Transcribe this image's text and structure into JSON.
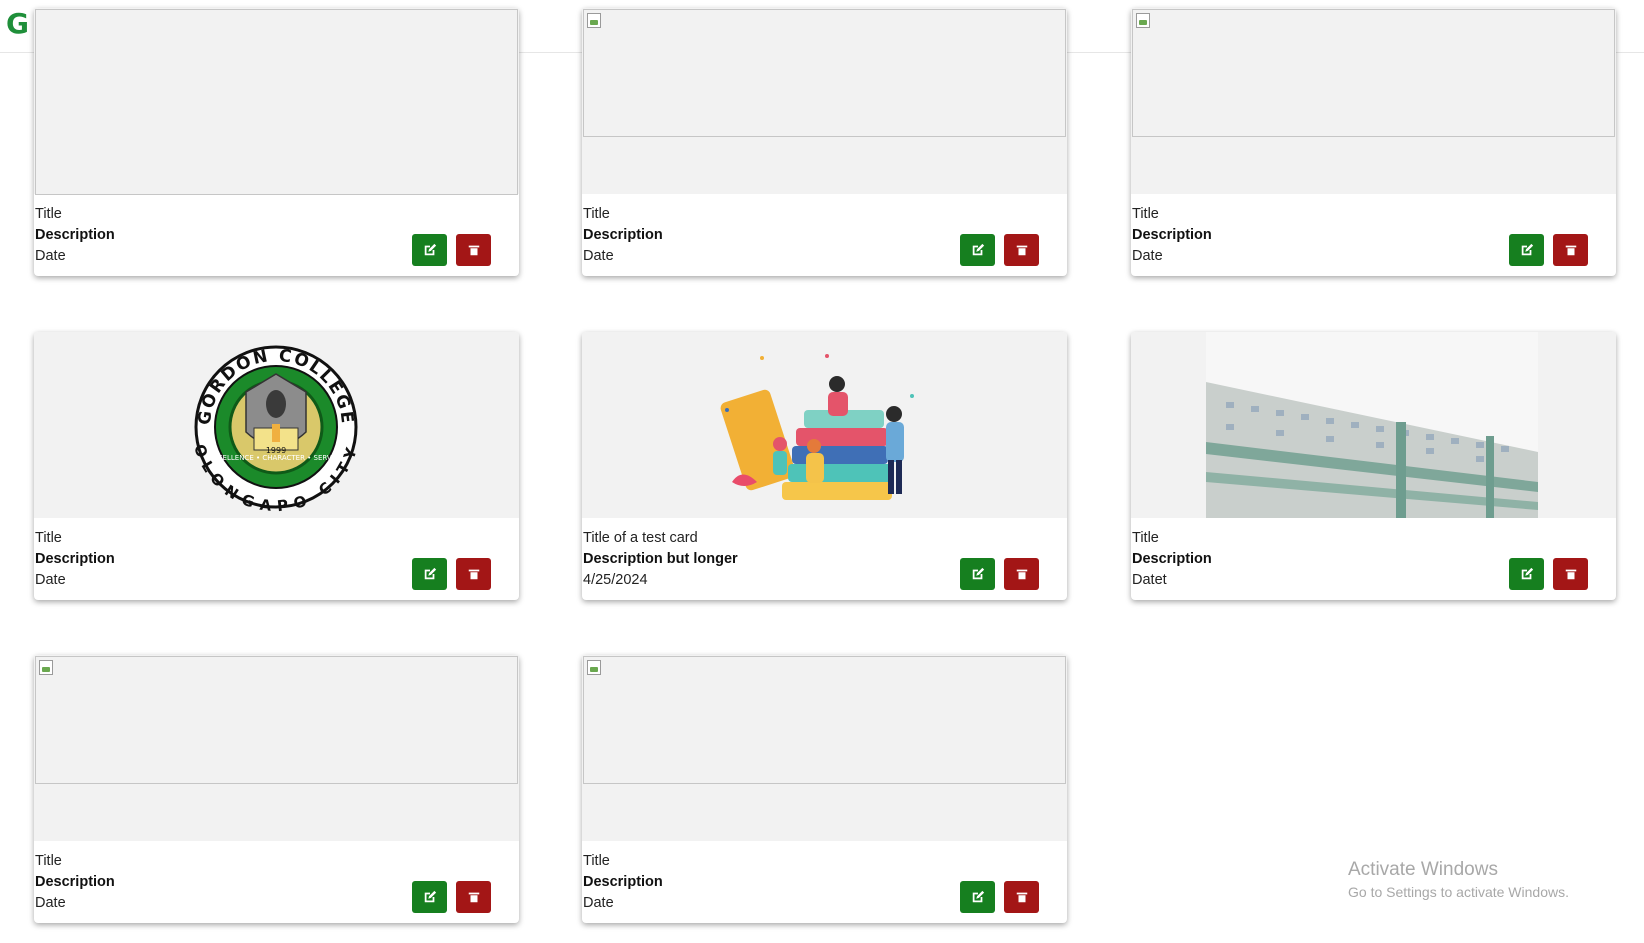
{
  "header": {
    "logo_letter": "G",
    "logo_color": "#1f8f3a"
  },
  "cards": [
    {
      "title": "Title",
      "description": "Description",
      "date": "Date",
      "image": "broken"
    },
    {
      "title": "Title",
      "description": "Description",
      "date": "Date",
      "image": "broken"
    },
    {
      "title": "Title",
      "description": "Description",
      "date": "Date",
      "image": "broken"
    },
    {
      "title": "Title",
      "description": "Description",
      "date": "Date",
      "image": "gordon-college-seal",
      "seal_top": "GORDON COLLEGE",
      "seal_bottom": "OLONGAPO CITY",
      "seal_year": "1999",
      "seal_motto": "EXCELLENCE • CHARACTER • SERVICE"
    },
    {
      "title": "Title of a test card",
      "description": "Description but longer",
      "date": "4/25/2024",
      "image": "books-illustration"
    },
    {
      "title": "Title",
      "description": "Description",
      "date": "Datet",
      "image": "campus-building-photo"
    },
    {
      "title": "Title",
      "description": "Description",
      "date": "Date",
      "image": "broken"
    },
    {
      "title": "Title",
      "description": "Description",
      "date": "Date",
      "image": "broken"
    }
  ],
  "buttons": {
    "edit_icon": "edit-icon",
    "delete_icon": "trash-icon",
    "edit_color": "#167f1f",
    "delete_color": "#a31616"
  },
  "watermark": {
    "line1": "Activate Windows",
    "line2": "Go to Settings to activate Windows."
  }
}
